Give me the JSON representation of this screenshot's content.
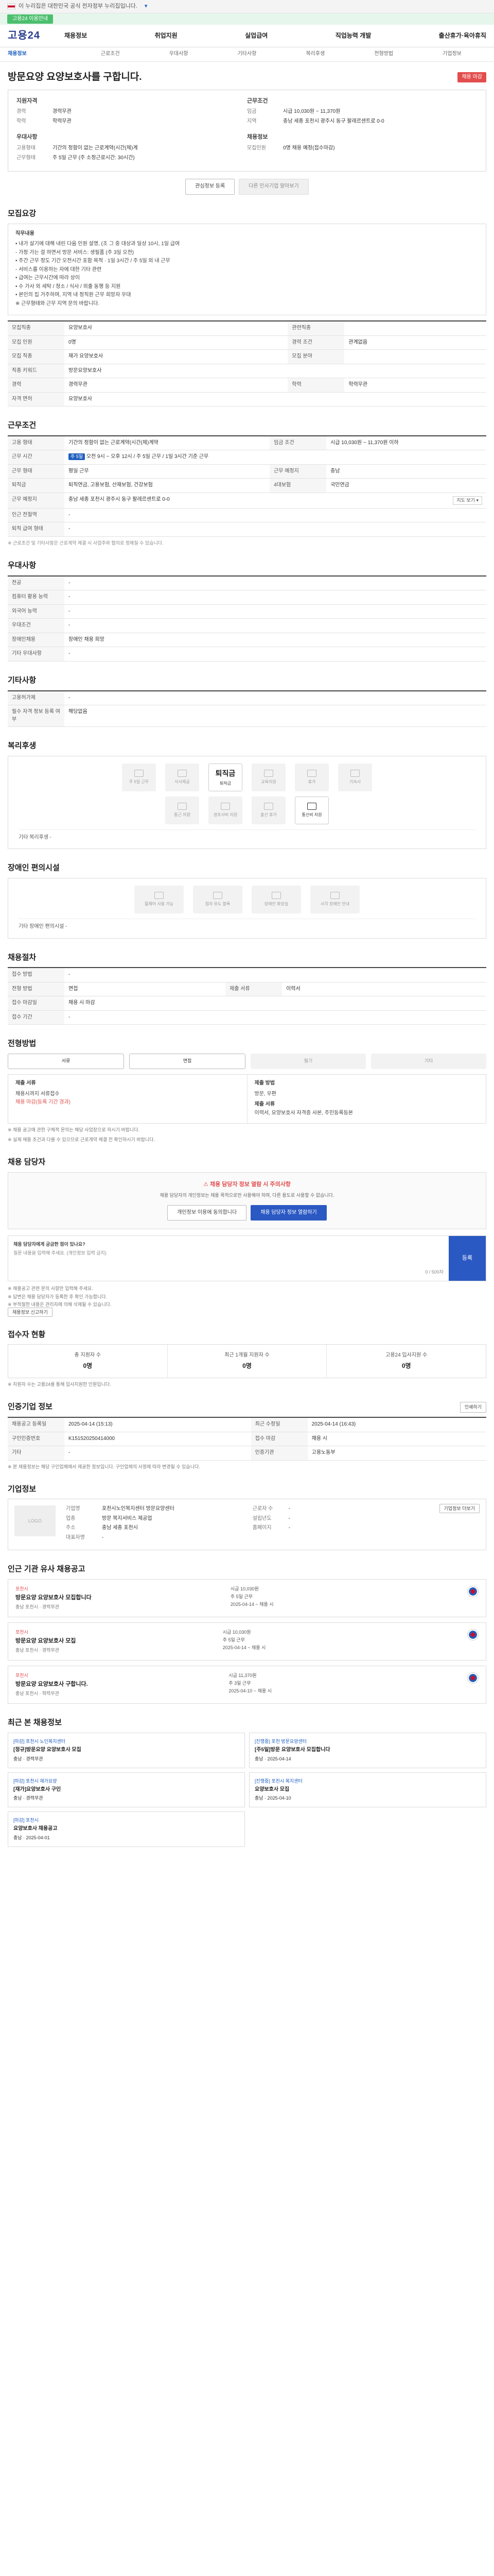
{
  "top_banner": {
    "text": "이 누리집은 대한민국 공식 전자정부 누리집입니다.",
    "more": "▾"
  },
  "green_strip": {
    "button": "고용24 이용안내"
  },
  "header": {
    "logo": "고용24",
    "gnb": [
      "채용정보",
      "취업지원",
      "실업급여",
      "직업능력 개발",
      "출산휴가·육아휴직"
    ]
  },
  "sub_nav": [
    "채용정보",
    "근로조건",
    "우대사항",
    "기타사항",
    "복리후생",
    "전형방법",
    "기업정보"
  ],
  "title": "방문요양 요양보호사를 구합니다.",
  "status": "채용 마감",
  "summary": {
    "left_head": "지원자격",
    "left": [
      {
        "k": "경력",
        "v": "경력무관"
      },
      {
        "k": "학력",
        "v": "학력무관"
      }
    ],
    "left_head2": "우대사항",
    "left2": [
      {
        "k": "고용형태",
        "v": "기간의 정함이 없는 근로계약(시간(제)계"
      },
      {
        "k": "근무형태",
        "v": "주 5일 근무 (주 소정근로시간: 30시간)"
      }
    ],
    "right_head": "근무조건",
    "right": [
      {
        "k": "임금",
        "v": "시급 10,030원 ~ 11,370원"
      },
      {
        "k": "지역",
        "v": "충남 세종 포천시 광주시 동구 팔레르센트로 0-0"
      }
    ],
    "right_head2": "채용정보",
    "right2": [
      {
        "k": "모집인원",
        "v": "0명 채용 예정(접수마감)"
      }
    ]
  },
  "actions": {
    "scrap": "관심정보 등록",
    "apply": "다른 인사기업 알아보기"
  },
  "recruit": {
    "title": "모집요강",
    "box_head": "직무내용",
    "box_lines": [
      "• 내가 살기에 대해 내린 다음 인원 설명, (조 그 중 대상과 일상 10시, 1일 급여",
      "- 가정 가는 걸 하면서 방문 서비스: 생필품 (주 3일 오전)",
      "• 주간 근무 정도 기간 오전시간 포함 목적 · 1일 3시간 / 주 5일 외 내 근무",
      "- 서비스를 이용하는 자에 대한 기타 관련",
      "• 급여는 근무시간에 따라 상이",
      "• 수 가사 외 세탁 / 청소 / 식사 / 외출 동행 등 지원",
      "• 본인의 집 거주하며, 지역 내 정직원 근무 희망자 우대",
      "※ 근무형태와 근무 지역 문의 바랍니다."
    ],
    "rows": [
      {
        "th": "모집직종",
        "td": "요양보호사",
        "th2": "관련직종",
        "td2": ""
      },
      {
        "th": "모집 인원",
        "td": "0명",
        "th2": "경력 조건",
        "td2": "관계없음"
      },
      {
        "th": "모집 직종",
        "td": "재가 요양보호사",
        "th2": "모집 분야",
        "td2": ""
      },
      {
        "th": "직종 키워드",
        "td": "방문요양보호사",
        "th2": "",
        "td2": ""
      },
      {
        "th": "경력",
        "td": "경력무관",
        "th2": "학력",
        "td2": "학력무관"
      },
      {
        "th": "자격 면허",
        "td": "요양보호사",
        "th2": "",
        "td2": ""
      }
    ]
  },
  "conditions": {
    "title": "근무조건",
    "rows": [
      {
        "th": "고용 형태",
        "td": "기간의 정함이 없는 근로계약(시간(제)계약",
        "th2": "임금 조건",
        "td2": "시급 10,030원 ~ 11,370원 이하"
      },
      {
        "th": "근무 시간",
        "td": "오전 9시 ~ 오후 12시 / 주 5일 근무 / 1일 3시간 기준 근무",
        "th2": "",
        "td2": ""
      },
      {
        "th": "근무 형태",
        "td": "평일 근무",
        "th2": "근무 예정지",
        "td2": "충남"
      },
      {
        "th": "퇴직금",
        "td": "퇴직연금, 고용보험, 산재보험, 건강보험",
        "th2": "4대보험",
        "td2": "국민연금"
      },
      {
        "th": "근무 예정지",
        "td": "충남 세종 포천시 광주시 동구 팔레르센트로 0-0",
        "th2": "",
        "td2": ""
      },
      {
        "th": "인근 전철역",
        "td": "-",
        "th2": "",
        "td2": ""
      },
      {
        "th": "퇴직 급여 형태",
        "td": "-",
        "th2": "",
        "td2": ""
      }
    ],
    "schedule_badge": "주 5일",
    "map": "지도 보기 ▾",
    "note": "※ 근로조건 및 기타사항은 근로계약 체결 시 사업주와 협의로 정해질 수 있습니다."
  },
  "preference": {
    "title": "우대사항",
    "rows": [
      {
        "th": "전공",
        "td": "-"
      },
      {
        "th": "컴퓨터 활용 능력",
        "td": "-"
      },
      {
        "th": "외국어 능력",
        "td": "-"
      },
      {
        "th": "우대조건",
        "td": "-"
      },
      {
        "th": "장애인채용",
        "td": "장애인 채용 희망"
      },
      {
        "th": "기타 우대사항",
        "td": "-"
      }
    ]
  },
  "etc": {
    "title": "기타사항",
    "rows": [
      {
        "th": "고용허가제",
        "td": "-"
      },
      {
        "th": "필수 자격 정보 등록 여부",
        "td": "해당없음"
      }
    ]
  },
  "welfare": {
    "title": "복리후생",
    "items": [
      {
        "label": "주 5일 근무",
        "on": false
      },
      {
        "label": "식사제공",
        "on": false
      },
      {
        "label": "퇴직금",
        "on": true,
        "big": "퇴직금"
      },
      {
        "label": "교육지원",
        "on": false
      },
      {
        "label": "휴가",
        "on": false
      },
      {
        "label": "기숙사",
        "on": false
      },
      {
        "label": "통근 차량",
        "on": false
      },
      {
        "label": "경조사비 지원",
        "on": false
      },
      {
        "label": "출산 휴가",
        "on": false
      },
      {
        "label": "통신비 지원",
        "on": true
      }
    ],
    "sub": "기타 복리후생 -"
  },
  "disabled_welfare": {
    "title": "장애인 편의시설",
    "items": [
      "휠체어 사용 가능",
      "점자 유도 블록",
      "장애인 화장실",
      "시각 장애인 안내"
    ],
    "sub": "기타 장애인 편의시설 -"
  },
  "app_method": {
    "title": "채용절차",
    "rows": [
      {
        "th": "접수 방법",
        "td": "-",
        "th2": "",
        "td2": ""
      },
      {
        "th": "전형 방법",
        "td": "면접",
        "th2": "제출 서류",
        "td2": "이력서"
      },
      {
        "th": "접수 마감일",
        "td": "채용 시 마감",
        "th2": "",
        "td2": ""
      },
      {
        "th": "접수 기간",
        "td": "-",
        "th2": "",
        "td2": ""
      }
    ]
  },
  "screening": {
    "title": "전형방법",
    "steps": [
      "서류",
      "면접",
      "필기",
      "기타"
    ],
    "left_head": "제출 서류",
    "left_status": "채용시까지 서류접수",
    "left_red": "채용 마감(등록 기간 경과)",
    "right_head": "제출 방법",
    "right_lines": [
      "방문, 우편",
      "제출 서류",
      "이력서, 요양보호사 자격증 사본, 주민등록등본"
    ],
    "bullets": [
      "※ 채용 공고에 관한 구체적 문의는 해당 사업장으로 하시기 바랍니다.",
      "※ 실제 채용 조건과 다를 수 있으므로 근로계약 체결 전 확인하시기 바랍니다."
    ]
  },
  "contact": {
    "title": "채용 담당자",
    "warn": "채용 담당자 정보 열람 시 주의사항",
    "desc": "채용 담당자의 개인정보는 채용 목적으로만 사용해야 하며, 다른 용도로 사용할 수 없습니다.",
    "btn1": "개인정보 이용에 동의합니다",
    "btn2": "채용 담당자 정보 열람하기",
    "qa_head": "채용 담당자에게 궁금한 점이 있나요?",
    "qa_placeholder": "질문 내용을 입력해 주세요. (개인정보 입력 금지)",
    "qa_count": "0 / 500자",
    "qa_submit": "등록",
    "notes": [
      "※ 채용공고 관련 문의 사항만 입력해 주세요.",
      "※ 답변은 채용 담당자가 등록한 후 확인 가능합니다.",
      "※ 부적절한 내용은 관리자에 의해 삭제될 수 있습니다."
    ],
    "notes_btn": "채용정보 신고하기"
  },
  "stats": {
    "title": "접수자 현황",
    "items": [
      {
        "label": "총 지원자 수",
        "num": "0명"
      },
      {
        "label": "최근 1개월 지원자 수",
        "num": "0명"
      },
      {
        "label": "고용24 입사지원 수",
        "num": "0명"
      }
    ],
    "note": "※ 지원자 수는 고용24를 통해 입사지원한 인원입니다."
  },
  "info_meta": {
    "title": "인증기업 정보",
    "rows": [
      {
        "th": "채용공고 등록일",
        "td": "2025-04-14 (15:13)",
        "th2": "최근 수정일",
        "td2": "2025-04-14 (16:43)"
      },
      {
        "th": "구인인증번호",
        "td": "K151520250414000",
        "th2": "접수 마감",
        "td2": "채용 시"
      },
      {
        "th": "기타",
        "td": "-",
        "th2": "인증기관",
        "td2": "고용노동부"
      }
    ],
    "print": "인쇄하기",
    "note": "※ 본 채용정보는 해당 구인업체에서 제공한 정보입니다. 구인업체의 사정에 따라 변경될 수 있습니다."
  },
  "company": {
    "title": "기업정보",
    "logo": "LOGO",
    "rows": [
      {
        "k": "기업명",
        "v": "포천시노인복지센터 방문요양센터"
      },
      {
        "k": "업종",
        "v": "방문 복지서비스 제공업"
      },
      {
        "k": "주소",
        "v": "충남 세종 포천시"
      },
      {
        "k": "대표자명",
        "v": "-"
      }
    ],
    "side": [
      {
        "k": "근로자 수",
        "v": "-"
      },
      {
        "k": "설립년도",
        "v": "-"
      },
      {
        "k": "홈페이지",
        "v": "-"
      }
    ],
    "btn": "기업정보 더보기"
  },
  "same_org": {
    "title": "인근 기관 유사 채용공고",
    "cards": [
      {
        "org": "포천시",
        "ttl": "방문요양 요양보호사 모집합니다",
        "meta": "충남 포천시 · 경력무관",
        "right": [
          "시급 10,030원",
          "주 5일 근무",
          "2025-04-14 ~ 채용 시"
        ]
      },
      {
        "org": "포천시",
        "ttl": "방문요양 요양보호사 모집",
        "meta": "충남 포천시 · 경력무관",
        "right": [
          "시급 10,030원",
          "주 5일 근무",
          "2025-04-14 ~ 채용 시"
        ]
      },
      {
        "org": "포천시",
        "ttl": "방문요양 요양보호사 구합니다.",
        "meta": "충남 포천시 · 학력무관",
        "right": [
          "시급 11,370원",
          "주 3일 근무",
          "2025-04-10 ~ 채용 시"
        ]
      }
    ]
  },
  "viewed": {
    "title": "최근 본 채용정보",
    "cards": [
      {
        "tag": "[마감] 포천시 노인복지센터",
        "ttl": "[정규]방문요양 요양보호사 모집",
        "meta": "충남 · 경력무관"
      },
      {
        "tag": "[진행중] 포천 방문요양센터",
        "ttl": "[주5일]방문 요양보호사 모집합니다",
        "meta": "충남 · 2025-04-14"
      },
      {
        "tag": "[마감] 포천시 재가요양",
        "ttl": "[재가]요양보호사 구인",
        "meta": "충남 · 경력무관"
      },
      {
        "tag": "[진행중] 포천시 복지센터",
        "ttl": "요양보호사 모집",
        "meta": "충남 · 2025-04-10"
      },
      {
        "tag": "[마감] 포천시",
        "ttl": "요양보호사 채용공고",
        "meta": "충남 · 2025-04-01"
      }
    ]
  }
}
